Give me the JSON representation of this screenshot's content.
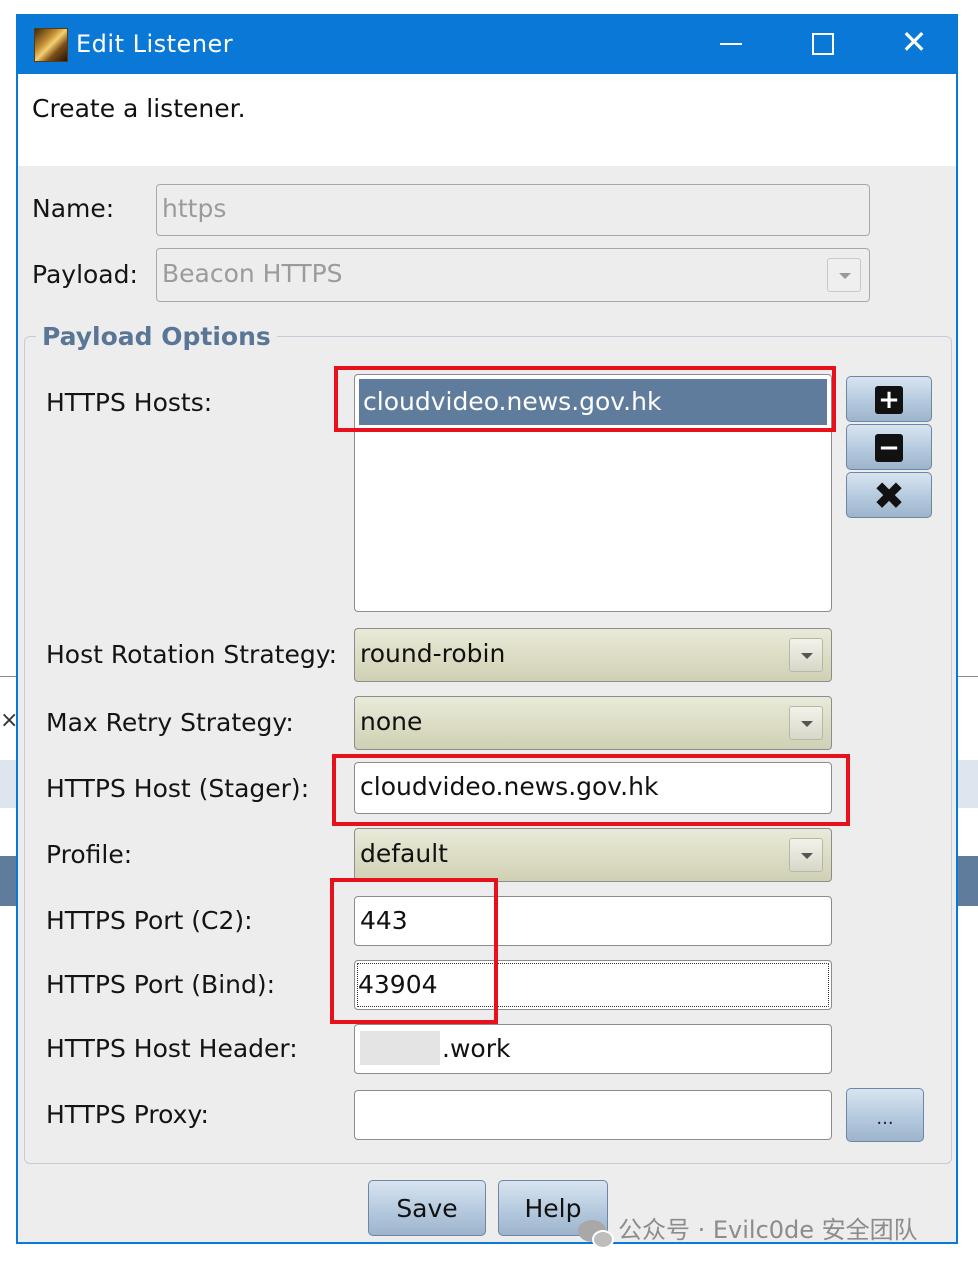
{
  "window": {
    "title": "Edit Listener",
    "minimize_icon": "minimize-icon",
    "maximize_icon": "maximize-icon",
    "close_glyph": "✕"
  },
  "description": "Create a listener.",
  "form": {
    "name_label": "Name:",
    "name_value": "https",
    "payload_label": "Payload:",
    "payload_value": "Beacon HTTPS"
  },
  "payload_options": {
    "title": "Payload Options",
    "https_hosts_label": "HTTPS Hosts:",
    "https_hosts": [
      "cloudvideo.news.gov.hk"
    ],
    "add_icon": "plus-icon",
    "remove_icon": "minus-icon",
    "clear_icon": "x-icon",
    "host_rotation_label": "Host Rotation Strategy:",
    "host_rotation_value": "round-robin",
    "max_retry_label": "Max Retry Strategy:",
    "max_retry_value": "none",
    "stager_host_label": "HTTPS Host (Stager):",
    "stager_host_value": "cloudvideo.news.gov.hk",
    "profile_label": "Profile:",
    "profile_value": "default",
    "port_c2_label": "HTTPS Port (C2):",
    "port_c2_value": "443",
    "port_bind_label": "HTTPS Port (Bind):",
    "port_bind_value": "43904",
    "host_header_label": "HTTPS Host Header:",
    "host_header_value": ".work",
    "proxy_label": "HTTPS Proxy:",
    "proxy_value": "",
    "proxy_button": "..."
  },
  "buttons": {
    "save": "Save",
    "help": "Help"
  },
  "watermark": "公众号 · Evilc0de 安全团队",
  "colors": {
    "titlebar": "#0a78d7",
    "selection": "#5f7c9c",
    "highlight_box": "#e8101a",
    "group_title": "#5a7696"
  }
}
